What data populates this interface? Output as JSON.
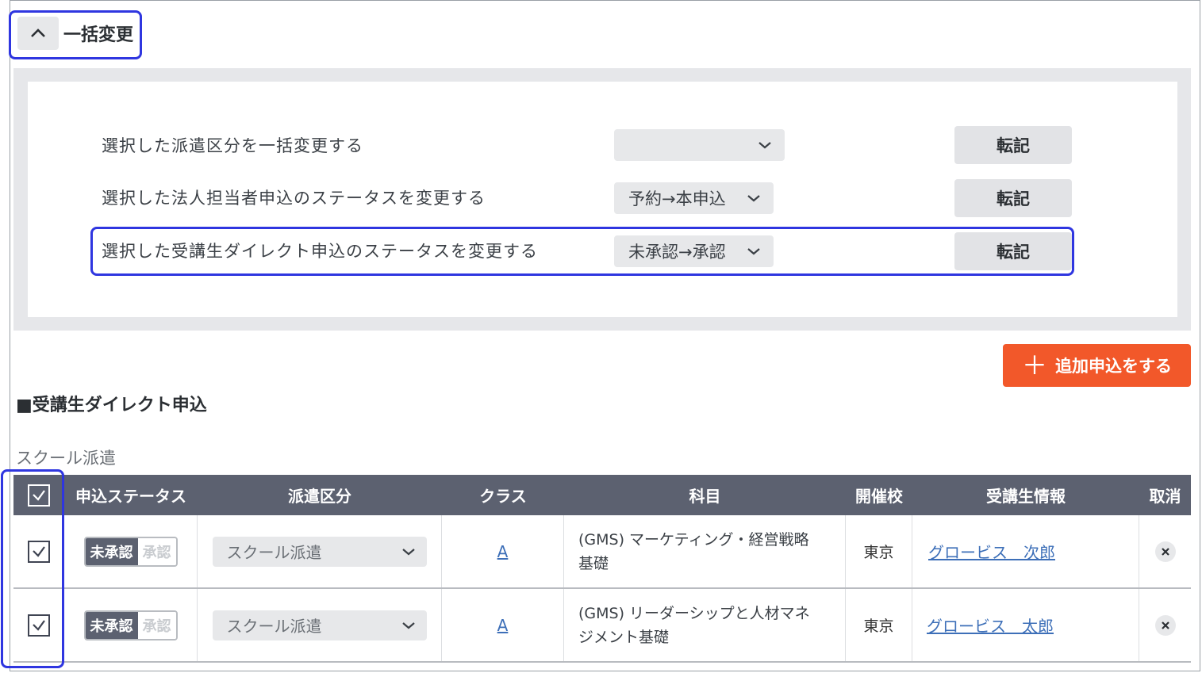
{
  "bulk_toggle": {
    "label": "一括変更"
  },
  "bulk": {
    "rows": [
      {
        "label": "選択した派遣区分を一括変更する",
        "select_value": "",
        "button": "転記"
      },
      {
        "label": "選択した法人担当者申込のステータスを変更する",
        "select_value": "予約→本申込",
        "button": "転記"
      },
      {
        "label": "選択した受講生ダイレクト申込のステータスを変更する",
        "select_value": "未承認→承認",
        "button": "転記"
      }
    ]
  },
  "add_button": {
    "label": "追加申込をする"
  },
  "section": {
    "title": "■受講生ダイレクト申込",
    "subtitle": "スクール派遣"
  },
  "table": {
    "headers": [
      "申込ステータス",
      "派遣区分",
      "クラス",
      "科目",
      "開催校",
      "受講生情報",
      "取消"
    ],
    "rows": [
      {
        "status_on": "未承認",
        "status_off": "承認",
        "dispatch": "スクール派遣",
        "class": "A",
        "subject_line1": "(GMS) マーケティング・経営戦略",
        "subject_line2": "基礎",
        "school": "東京",
        "student": "グロービス　次郎"
      },
      {
        "status_on": "未承認",
        "status_off": "承認",
        "dispatch": "スクール派遣",
        "class": "A",
        "subject_line1": "(GMS) リーダーシップと人材マネ",
        "subject_line2": "ジメント基礎",
        "school": "東京",
        "student": "グロービス　太郎"
      }
    ]
  },
  "colors": {
    "accent": "#f2582a",
    "header_bg": "#5c6170",
    "highlight": "#2f36e0",
    "link": "#3d6fb8"
  },
  "icons": [
    "chevron-up-icon",
    "chevron-down-icon",
    "plus-icon",
    "checkbox-checked-icon",
    "close-icon"
  ]
}
